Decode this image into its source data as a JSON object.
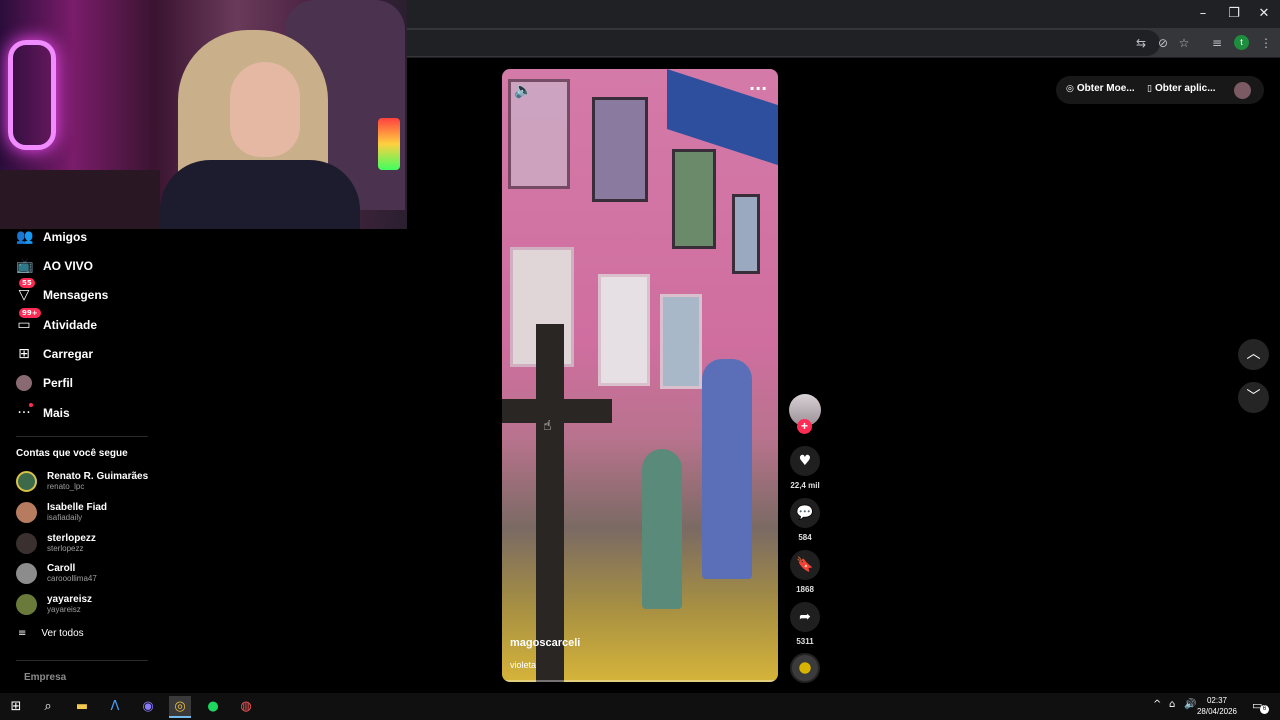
{
  "window_controls": {
    "minimize": "–",
    "restore": "❐",
    "close": "✕"
  },
  "browser_toolbar": {
    "icons": [
      "translate-icon",
      "eye-off-icon",
      "star-icon",
      "playlist-icon",
      "profile-icon",
      "menu-icon"
    ],
    "profile_letter": "t"
  },
  "sidebar": {
    "items": [
      {
        "label": "Amigos",
        "icon": "friends-icon"
      },
      {
        "label": "AO VIVO",
        "icon": "live-tv-icon"
      },
      {
        "label": "Mensagens",
        "icon": "messages-icon",
        "badge": "55"
      },
      {
        "label": "Atividade",
        "icon": "activity-icon",
        "badge": "99+"
      },
      {
        "label": "Carregar",
        "icon": "upload-icon"
      },
      {
        "label": "Perfil",
        "icon": "profile-avatar"
      },
      {
        "label": "Mais",
        "icon": "more-icon"
      }
    ],
    "following_title": "Contas que você segue",
    "accounts": [
      {
        "name": "Renato R. Guimarães",
        "handle": "renato_lpc",
        "color": "#3d6b4a"
      },
      {
        "name": "Isabelle Fiad",
        "handle": "isafiadaily",
        "color": "#b77b5f"
      },
      {
        "name": "sterlopezz",
        "handle": "sterlopezz",
        "color": "#3a3030"
      },
      {
        "name": "Caroll",
        "handle": "carooollima47",
        "color": "#8c8c8c"
      },
      {
        "name": "yayareisz",
        "handle": "yayareisz",
        "color": "#6a7a3a"
      }
    ],
    "see_all": "Ver todos",
    "footer": "Empresa"
  },
  "video": {
    "author": "magoscarceli",
    "description": "violeta",
    "progress": 0.0
  },
  "actions": {
    "likes": "22,4 mil",
    "comments": "584",
    "saves": "1868",
    "shares": "5311"
  },
  "top_right": {
    "coins_label": "Obter Moe...",
    "app_label": "Obter aplic..."
  },
  "taskbar": {
    "time": "02:37",
    "date": "28/04/2026",
    "notification_count": "6"
  },
  "colors": {
    "accent": "#fe2c55",
    "background": "#000000"
  }
}
